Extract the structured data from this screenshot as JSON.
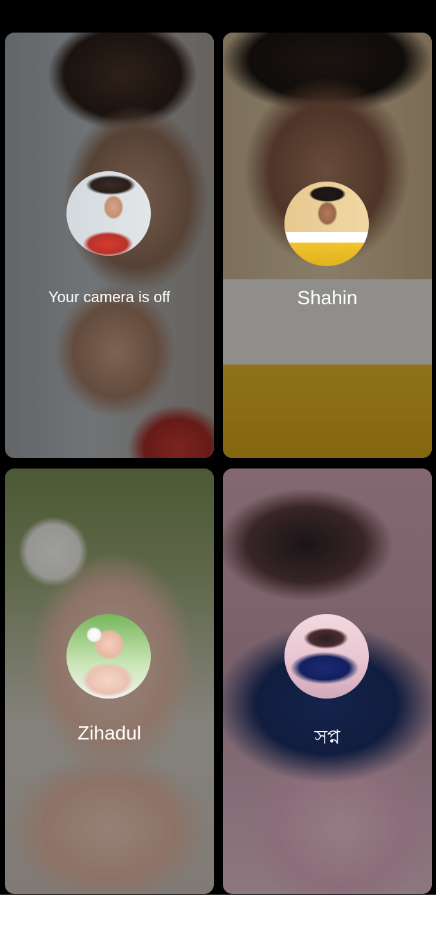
{
  "participants": [
    {
      "label": "Your camera is off",
      "avatar_icon": "avatar-icon"
    },
    {
      "label": "Shahin",
      "avatar_icon": "avatar-icon"
    },
    {
      "label": "Zihadul",
      "avatar_icon": "avatar-icon"
    },
    {
      "label": "সপ্ন",
      "avatar_icon": "avatar-icon"
    }
  ]
}
